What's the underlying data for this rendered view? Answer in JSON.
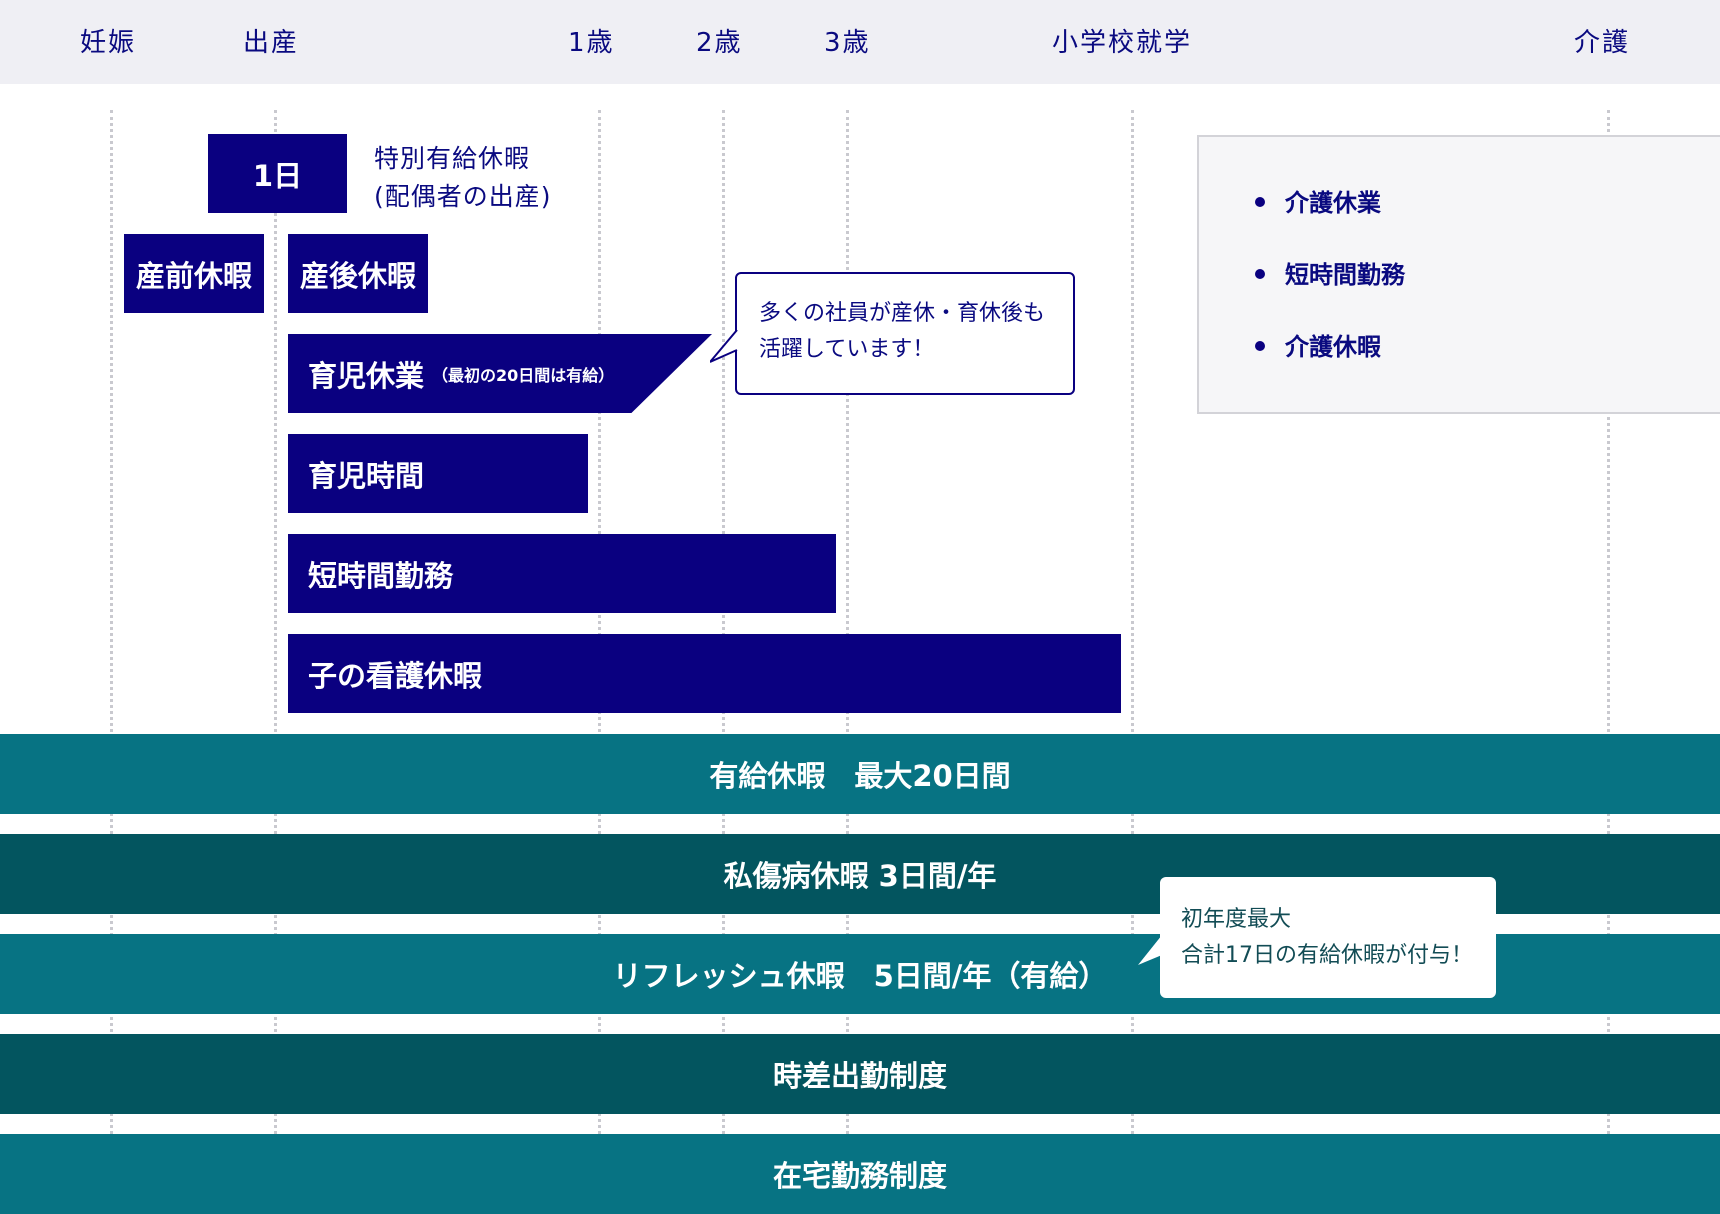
{
  "header": {
    "labels": [
      "妊娠",
      "出産",
      "1歳",
      "2歳",
      "3歳",
      "小学校就学",
      "介護"
    ]
  },
  "special_leave": {
    "badge": "1日",
    "note_line1": "特別有給休暇",
    "note_line2": "(配偶者の出産)"
  },
  "bars": {
    "prenatal": "産前休暇",
    "postnatal": "産後休暇",
    "childcare_leave": "育児休業",
    "childcare_leave_note": "（最初の20日間は有給）",
    "childcare_time": "育児時間",
    "short_hours": "短時間勤務",
    "nursing_leave": "子の看護休暇"
  },
  "bubble_childcare": {
    "line1": "多くの社員が産休・育休後も",
    "line2": "活躍しています！"
  },
  "care": {
    "items": [
      "介護休業",
      "短時間勤務",
      "介護休暇"
    ]
  },
  "bands": {
    "paid_leave": "有給休暇　最大20日間",
    "sick_leave": "私傷病休暇 3日間/年",
    "refresh_leave": "リフレッシュ休暇　5日間/年（有給）",
    "staggered": "時差出勤制度",
    "remote": "在宅勤務制度"
  },
  "bubble_paid": {
    "line1": "初年度最大",
    "line2": "合計17日の有給休暇が付与！"
  },
  "colors": {
    "navy": "#0a0080",
    "teal_light": "#077383",
    "teal_dark": "#03555f",
    "header_bg": "#efeff4"
  }
}
